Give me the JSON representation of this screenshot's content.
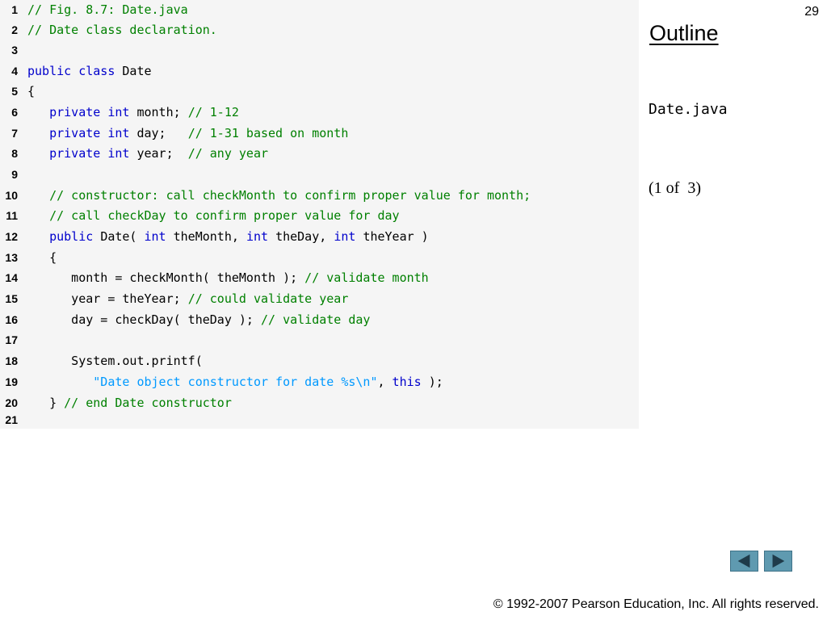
{
  "slide_number": "29",
  "sidebar": {
    "title": "Outline",
    "file_name": "Date.java",
    "page_indicator": "(1 of  3)"
  },
  "footer": {
    "copyright": "© 1992-2007 Pearson Education, Inc.  All rights reserved."
  },
  "nav": {
    "prev_icon": "left-triangle",
    "next_icon": "right-triangle",
    "button_color": "#5f9ab0"
  },
  "colors": {
    "keyword": "#0000cc",
    "comment": "#008000",
    "string": "#0099ff",
    "panel_bg": "#f5f5f5"
  },
  "code": [
    {
      "n": "1",
      "tokens": [
        {
          "t": "// Fig. 8.7: Date.java",
          "c": "cm"
        }
      ]
    },
    {
      "n": "2",
      "tokens": [
        {
          "t": "// Date class declaration.",
          "c": "cm"
        }
      ]
    },
    {
      "n": "3",
      "tokens": []
    },
    {
      "n": "4",
      "tokens": [
        {
          "t": "public class ",
          "c": "kw"
        },
        {
          "t": "Date",
          "c": "pl"
        }
      ]
    },
    {
      "n": "5",
      "tokens": [
        {
          "t": "{",
          "c": "pl"
        }
      ]
    },
    {
      "n": "6",
      "tokens": [
        {
          "t": "   ",
          "c": "pl"
        },
        {
          "t": "private int ",
          "c": "kw"
        },
        {
          "t": "month; ",
          "c": "pl"
        },
        {
          "t": "// 1-12",
          "c": "cm"
        }
      ]
    },
    {
      "n": "7",
      "tokens": [
        {
          "t": "   ",
          "c": "pl"
        },
        {
          "t": "private int ",
          "c": "kw"
        },
        {
          "t": "day;   ",
          "c": "pl"
        },
        {
          "t": "// 1-31 based on month",
          "c": "cm"
        }
      ]
    },
    {
      "n": "8",
      "tokens": [
        {
          "t": "   ",
          "c": "pl"
        },
        {
          "t": "private int ",
          "c": "kw"
        },
        {
          "t": "year;  ",
          "c": "pl"
        },
        {
          "t": "// any year",
          "c": "cm"
        }
      ]
    },
    {
      "n": "9",
      "tokens": []
    },
    {
      "n": "10",
      "tokens": [
        {
          "t": "   ",
          "c": "pl"
        },
        {
          "t": "// constructor: call checkMonth to confirm proper value for month;",
          "c": "cm"
        }
      ]
    },
    {
      "n": "11",
      "tokens": [
        {
          "t": "   ",
          "c": "pl"
        },
        {
          "t": "// call checkDay to confirm proper value for day",
          "c": "cm"
        }
      ]
    },
    {
      "n": "12",
      "tokens": [
        {
          "t": "   ",
          "c": "pl"
        },
        {
          "t": "public ",
          "c": "kw"
        },
        {
          "t": "Date( ",
          "c": "pl"
        },
        {
          "t": "int ",
          "c": "kw"
        },
        {
          "t": "theMonth, ",
          "c": "pl"
        },
        {
          "t": "int ",
          "c": "kw"
        },
        {
          "t": "theDay, ",
          "c": "pl"
        },
        {
          "t": "int ",
          "c": "kw"
        },
        {
          "t": "theYear )",
          "c": "pl"
        }
      ]
    },
    {
      "n": "13",
      "tokens": [
        {
          "t": "   {",
          "c": "pl"
        }
      ]
    },
    {
      "n": "14",
      "tokens": [
        {
          "t": "      month = checkMonth( theMonth ); ",
          "c": "pl"
        },
        {
          "t": "// validate month",
          "c": "cm"
        }
      ]
    },
    {
      "n": "15",
      "tokens": [
        {
          "t": "      year = theYear; ",
          "c": "pl"
        },
        {
          "t": "// could validate year",
          "c": "cm"
        }
      ]
    },
    {
      "n": "16",
      "tokens": [
        {
          "t": "      day = checkDay( theDay ); ",
          "c": "pl"
        },
        {
          "t": "// validate day",
          "c": "cm"
        }
      ]
    },
    {
      "n": "17",
      "tokens": []
    },
    {
      "n": "18",
      "tokens": [
        {
          "t": "      System.out.printf(",
          "c": "pl"
        }
      ]
    },
    {
      "n": "19",
      "tokens": [
        {
          "t": "         ",
          "c": "pl"
        },
        {
          "t": "\"Date object constructor for date %s\\n\"",
          "c": "st"
        },
        {
          "t": ", ",
          "c": "pl"
        },
        {
          "t": "this",
          "c": "kw"
        },
        {
          "t": " );",
          "c": "pl"
        }
      ]
    },
    {
      "n": "20",
      "tokens": [
        {
          "t": "   } ",
          "c": "pl"
        },
        {
          "t": "// end Date constructor",
          "c": "cm"
        }
      ]
    },
    {
      "n": "21",
      "tokens": []
    }
  ]
}
